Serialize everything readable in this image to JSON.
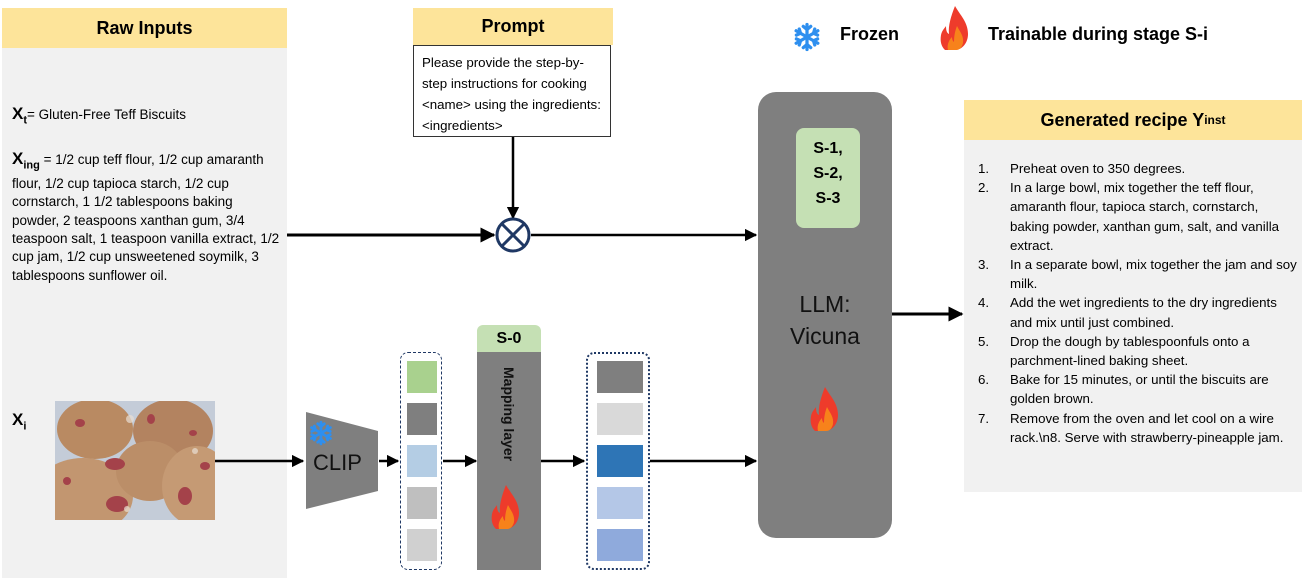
{
  "raw_inputs": {
    "title": "Raw Inputs",
    "xt": {
      "symbol": "X",
      "sub": "t",
      "text": "= Gluten-Free Teff Biscuits"
    },
    "xing": {
      "symbol": "X",
      "sub": "ing",
      "text": " = 1/2 cup teff flour, 1/2 cup amaranth flour, 1/2 cup tapioca starch, 1/2 cup cornstarch, 1 1/2 tablespoons baking powder, 2 teaspoons xanthan gum, 3/4 teaspoon salt, 1 teaspoon vanilla extract, 1/2 cup jam, 1/2 cup unsweetened soymilk, 3 tablespoons sunflower oil."
    },
    "xi": {
      "symbol": "X",
      "sub": "i",
      "image_desc": "biscuits-photo"
    }
  },
  "prompt": {
    "title": "Prompt",
    "text": "Please provide the step-by-step instructions for cooking <name> using the ingredients: <ingredients>"
  },
  "legend": {
    "frozen": {
      "icon": "snowflake-icon",
      "label": "Frozen",
      "color": "#2e8fef"
    },
    "trainable": {
      "icon": "flame-icon",
      "label": "Trainable during stage S-i",
      "color": "#ee3b2b"
    }
  },
  "clip": {
    "label": "CLIP",
    "state": "frozen"
  },
  "clip_embeddings": {
    "colors": [
      "#a9d18e",
      "#7f7f7f",
      "#b4cde4",
      "#bfbfbf",
      "#d0d0d0"
    ]
  },
  "mapping_layer": {
    "stage": "S-0",
    "label": "Mapping layer",
    "state": "trainable"
  },
  "mapped_embeddings": {
    "colors": [
      "#7f7f7f",
      "#d9d9d9",
      "#2e75b6",
      "#b4c7e7",
      "#8faadc"
    ]
  },
  "llm": {
    "stages": [
      "S-1,",
      "S-2,",
      "S-3"
    ],
    "label_line1": "LLM:",
    "label_line2": "Vicuna",
    "state": "trainable"
  },
  "fusion": {
    "operator": "⊗"
  },
  "generated": {
    "title": "Generated recipe Y",
    "title_sub": "inst",
    "steps": [
      "Preheat oven to 350 degrees.",
      "In a large bowl, mix together the teff flour, amaranth flour, tapioca starch, cornstarch, baking powder, xanthan gum, salt, and vanilla extract.",
      "In a separate bowl, mix together the jam and soy milk.",
      "Add the wet ingredients to the dry ingredients and mix until just combined.",
      "Drop the dough by tablespoonfuls onto a parchment-lined baking sheet.",
      "Bake for 15 minutes, or until the biscuits are golden brown.",
      "Remove from the oven and let cool on a wire rack.\\n8. Serve with strawberry-pineapple jam."
    ]
  }
}
